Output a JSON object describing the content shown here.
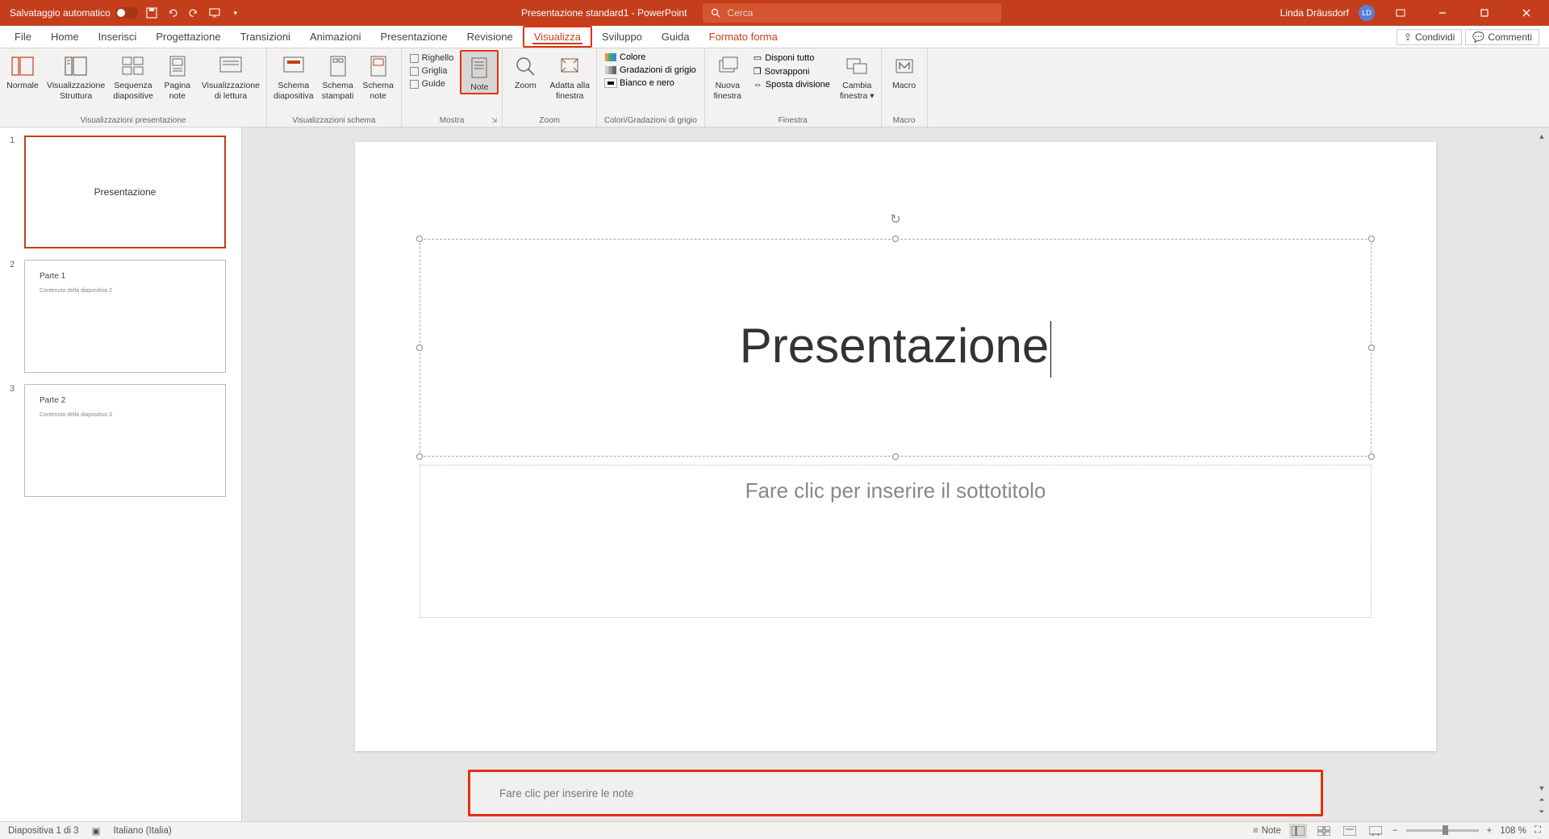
{
  "titlebar": {
    "autosave_label": "Salvataggio automatico",
    "doc_title": "Presentazione standard1 - PowerPoint",
    "search_placeholder": "Cerca",
    "user_name": "Linda Dräusdorf",
    "user_initials": "LD"
  },
  "tabs": {
    "file": "File",
    "home": "Home",
    "inserisci": "Inserisci",
    "progettazione": "Progettazione",
    "transizioni": "Transizioni",
    "animazioni": "Animazioni",
    "presentazione": "Presentazione",
    "revisione": "Revisione",
    "visualizza": "Visualizza",
    "sviluppo": "Sviluppo",
    "guida": "Guida",
    "formato_forma": "Formato forma",
    "condividi": "Condividi",
    "commenti": "Commenti"
  },
  "ribbon": {
    "grp_presentazione": "Visualizzazioni presentazione",
    "normale": "Normale",
    "struttura": "Visualizzazione\nStruttura",
    "sequenza": "Sequenza\ndiapositive",
    "pagina_note": "Pagina\nnote",
    "lettura": "Visualizzazione\ndi lettura",
    "grp_schema": "Visualizzazioni schema",
    "schema_diap": "Schema\ndiapositiva",
    "schema_stamp": "Schema\nstampati",
    "schema_note": "Schema\nnote",
    "grp_mostra": "Mostra",
    "righello": "Righello",
    "griglia": "Griglia",
    "guide": "Guide",
    "note": "Note",
    "grp_zoom": "Zoom",
    "zoom": "Zoom",
    "adatta": "Adatta alla\nfinestra",
    "grp_colori": "Colori/Gradazioni di grigio",
    "colore": "Colore",
    "grigio": "Gradazioni di grigio",
    "bn": "Bianco e nero",
    "grp_finestra": "Finestra",
    "nuova_fin": "Nuova\nfinestra",
    "disponi": "Disponi tutto",
    "sovrapponi": "Sovrapponi",
    "sposta": "Sposta divisione",
    "cambia_fin": "Cambia\nfinestra",
    "grp_macro": "Macro",
    "macro": "Macro"
  },
  "slides": [
    {
      "num": "1",
      "title": "Presentazione",
      "subtitle": ""
    },
    {
      "num": "2",
      "title": "Parte 1",
      "subtitle": "Contenuto della diapositiva 2"
    },
    {
      "num": "3",
      "title": "Parte 2",
      "subtitle": "Contenuto della diapositiva 3"
    }
  ],
  "canvas": {
    "title": "Presentazione",
    "subtitle_placeholder": "Fare clic per inserire il sottotitolo"
  },
  "notes": {
    "placeholder": "Fare clic per inserire le note"
  },
  "statusbar": {
    "slide_info": "Diapositiva 1 di 3",
    "language": "Italiano (Italia)",
    "note_btn": "Note",
    "zoom": "108 %"
  }
}
